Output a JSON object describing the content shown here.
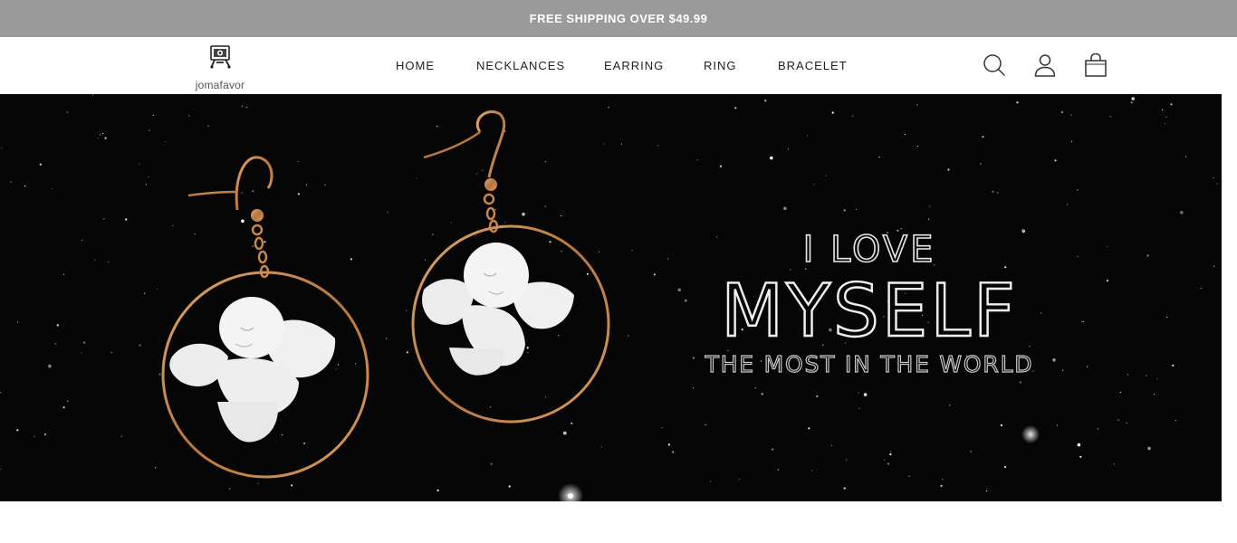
{
  "announcement": {
    "text": "FREE SHIPPING OVER $49.99"
  },
  "brand": {
    "name": "jomafavor"
  },
  "nav": {
    "items": [
      {
        "label": "HOME"
      },
      {
        "label": "NECKLANCES"
      },
      {
        "label": "EARRING"
      },
      {
        "label": "RING"
      },
      {
        "label": "BRACELET"
      }
    ]
  },
  "header_icons": [
    "search-icon",
    "account-icon",
    "cart-icon"
  ],
  "hero": {
    "line1": "I LOVE",
    "line2": "MYSELF",
    "line3": "THE MOST IN THE WORLD"
  },
  "colors": {
    "announcement_bg": "#9b9b9b",
    "hero_bg": "#060606",
    "gold": "#c8864a"
  }
}
